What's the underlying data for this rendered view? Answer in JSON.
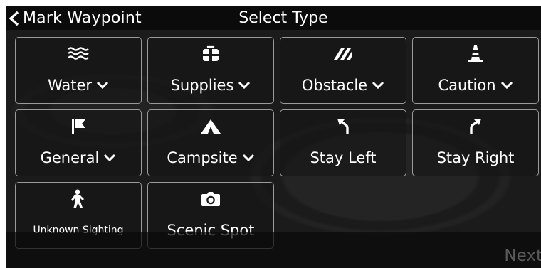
{
  "header": {
    "back_label": "Mark Waypoint",
    "title": "Select Type"
  },
  "tiles": [
    {
      "label": "Water",
      "icon": "water-icon",
      "dropdown": true
    },
    {
      "label": "Supplies",
      "icon": "supplies-icon",
      "dropdown": true
    },
    {
      "label": "Obstacle",
      "icon": "obstacle-icon",
      "dropdown": true
    },
    {
      "label": "Caution",
      "icon": "caution-cone-icon",
      "dropdown": true
    },
    {
      "label": "General",
      "icon": "flag-icon",
      "dropdown": true
    },
    {
      "label": "Campsite",
      "icon": "tent-icon",
      "dropdown": true
    },
    {
      "label": "Stay Left",
      "icon": "turn-left-arrow-icon",
      "dropdown": false
    },
    {
      "label": "Stay Right",
      "icon": "turn-right-arrow-icon",
      "dropdown": false
    },
    {
      "label": "Unknown Sighting",
      "icon": "bigfoot-icon",
      "dropdown": false
    },
    {
      "label": "Scenic Spot",
      "icon": "camera-icon",
      "dropdown": false
    }
  ],
  "footer": {
    "next_label": "Next"
  },
  "colors": {
    "background": "#1b1b1b",
    "topbar": "#0b0b0b",
    "tile_border": "#9a9a9a",
    "text": "#ffffff",
    "next_disabled": "#5a5a5a"
  }
}
